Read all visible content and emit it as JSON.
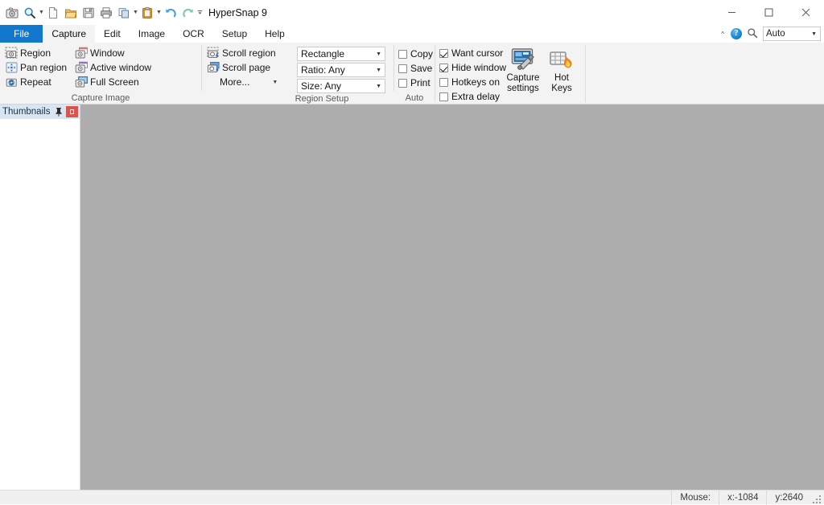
{
  "window": {
    "app_title": "HyperSnap 9",
    "controls": {
      "minimize": "minimize-icon",
      "maximize": "maximize-icon",
      "close": "close-icon"
    }
  },
  "quick_access": [
    {
      "name": "capture-icon",
      "label": "Capture"
    },
    {
      "name": "zoom-icon",
      "label": "Zoom",
      "has_dropdown": true
    },
    {
      "name": "new-icon",
      "label": "New"
    },
    {
      "name": "open-icon",
      "label": "Open"
    },
    {
      "name": "save-icon",
      "label": "Save"
    },
    {
      "name": "print-icon",
      "label": "Print"
    },
    {
      "name": "copy-icon",
      "label": "Copy",
      "has_dropdown": true
    },
    {
      "name": "paste-icon",
      "label": "Paste",
      "has_dropdown": true
    },
    {
      "name": "undo-icon",
      "label": "Undo"
    },
    {
      "name": "redo-icon",
      "label": "Redo"
    },
    {
      "name": "customize-quick-access-icon",
      "label": "Customize Quick Access Toolbar"
    }
  ],
  "tabs": [
    {
      "label": "File",
      "state": "file"
    },
    {
      "label": "Capture",
      "state": "active"
    },
    {
      "label": "Edit",
      "state": "normal"
    },
    {
      "label": "Image",
      "state": "normal"
    },
    {
      "label": "OCR",
      "state": "normal"
    },
    {
      "label": "Setup",
      "state": "normal"
    },
    {
      "label": "Help",
      "state": "normal"
    }
  ],
  "tabstrip_right": {
    "collapse_ribbon": "^",
    "help": "?",
    "find": "search-icon",
    "zoom_value": "Auto"
  },
  "ribbon": {
    "groups": [
      {
        "label": "Capture Image",
        "column_1": [
          {
            "label": "Region",
            "icon": "camera-region-icon"
          },
          {
            "label": "Pan region",
            "icon": "pan-region-icon"
          },
          {
            "label": "Repeat",
            "icon": "repeat-capture-icon"
          }
        ],
        "column_2": [
          {
            "label": "Window",
            "icon": "camera-window-icon"
          },
          {
            "label": "Active window",
            "icon": "camera-active-window-icon"
          },
          {
            "label": "Full Screen",
            "icon": "camera-full-screen-icon"
          }
        ]
      },
      {
        "label": "Region Setup",
        "column_1": [
          {
            "label": "Scroll region",
            "icon": "scroll-region-icon"
          },
          {
            "label": "Scroll page",
            "icon": "scroll-page-icon"
          },
          {
            "label": "More...",
            "icon": "more-icon",
            "has_dropdown": true
          }
        ],
        "dropdowns": [
          {
            "value": "Rectangle",
            "name": "region-shape-dropdown"
          },
          {
            "value": "Ratio: Any",
            "name": "region-ratio-dropdown"
          },
          {
            "value": "Size: Any",
            "name": "region-size-dropdown"
          }
        ]
      },
      {
        "label": "Auto",
        "checkboxes": [
          {
            "label": "Copy",
            "checked": false
          },
          {
            "label": "Save",
            "checked": false
          },
          {
            "label": "Print",
            "checked": false
          }
        ]
      }
    ],
    "options": [
      {
        "label": "Want cursor",
        "checked": true
      },
      {
        "label": "Hide window",
        "checked": true
      },
      {
        "label": "Hotkeys on",
        "checked": false
      },
      {
        "label": "Extra delay",
        "checked": false
      }
    ],
    "big_buttons": [
      {
        "line1": "Capture",
        "line2": "settings",
        "icon": "capture-settings-icon"
      },
      {
        "line1": "Hot",
        "line2": "Keys",
        "icon": "hot-keys-icon"
      }
    ]
  },
  "thumbnails_panel": {
    "title": "Thumbnails",
    "pin": "pin-icon",
    "close": "close-panel-icon"
  },
  "status_bar": {
    "mouse_label": "Mouse:",
    "x_value": "x:-1084",
    "y_value": "y:2640"
  },
  "colors": {
    "file_tab_blue": "#1278cd",
    "ribbon_bg": "#f3f3f3",
    "canvas_gray": "#adadad",
    "panel_header_blue": "#d9e6f2",
    "close_red": "#d9534f",
    "status_bg": "#f0f0f0"
  }
}
